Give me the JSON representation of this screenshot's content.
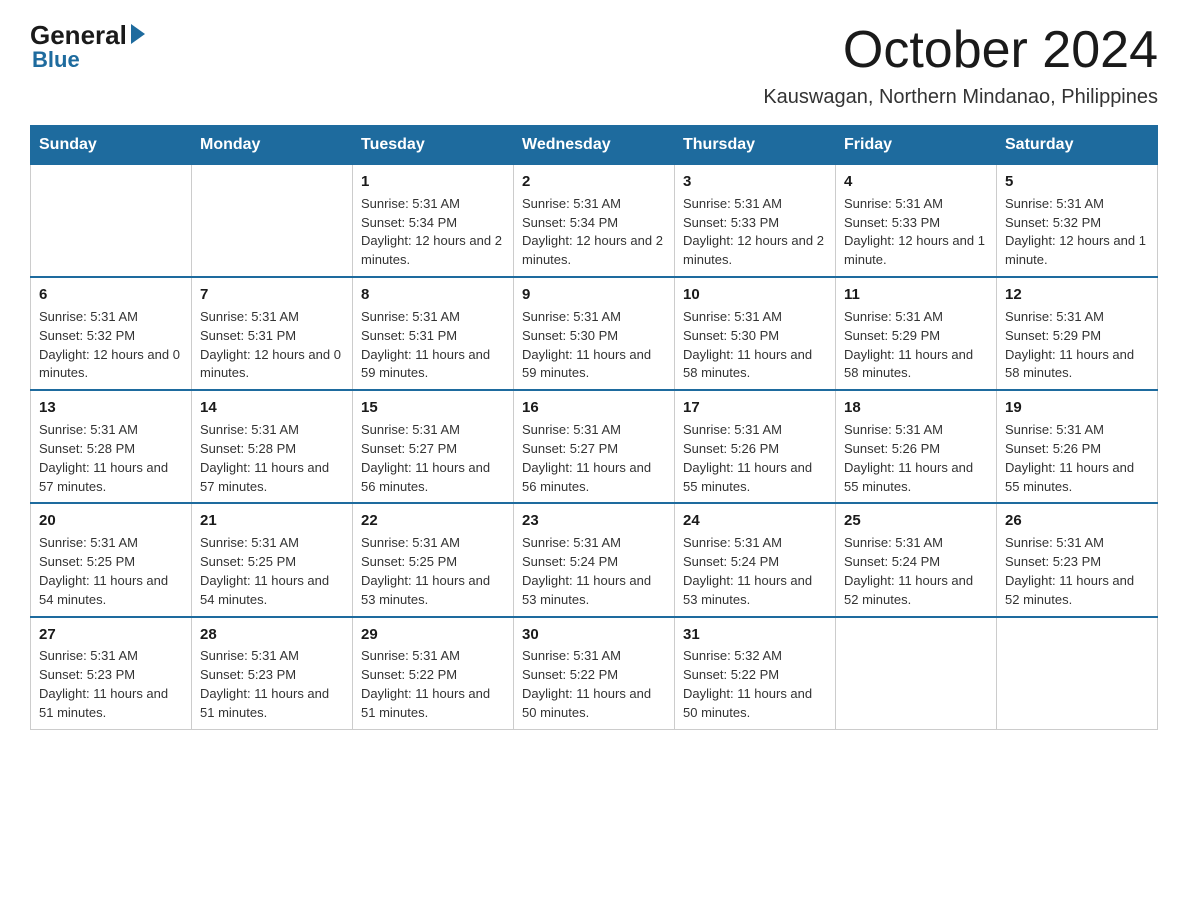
{
  "logo": {
    "general": "General",
    "blue": "Blue"
  },
  "title": "October 2024",
  "subtitle": "Kauswagan, Northern Mindanao, Philippines",
  "days_header": [
    "Sunday",
    "Monday",
    "Tuesday",
    "Wednesday",
    "Thursday",
    "Friday",
    "Saturday"
  ],
  "weeks": [
    [
      {
        "day": "",
        "info": ""
      },
      {
        "day": "",
        "info": ""
      },
      {
        "day": "1",
        "info": "Sunrise: 5:31 AM\nSunset: 5:34 PM\nDaylight: 12 hours and 2 minutes."
      },
      {
        "day": "2",
        "info": "Sunrise: 5:31 AM\nSunset: 5:34 PM\nDaylight: 12 hours and 2 minutes."
      },
      {
        "day": "3",
        "info": "Sunrise: 5:31 AM\nSunset: 5:33 PM\nDaylight: 12 hours and 2 minutes."
      },
      {
        "day": "4",
        "info": "Sunrise: 5:31 AM\nSunset: 5:33 PM\nDaylight: 12 hours and 1 minute."
      },
      {
        "day": "5",
        "info": "Sunrise: 5:31 AM\nSunset: 5:32 PM\nDaylight: 12 hours and 1 minute."
      }
    ],
    [
      {
        "day": "6",
        "info": "Sunrise: 5:31 AM\nSunset: 5:32 PM\nDaylight: 12 hours and 0 minutes."
      },
      {
        "day": "7",
        "info": "Sunrise: 5:31 AM\nSunset: 5:31 PM\nDaylight: 12 hours and 0 minutes."
      },
      {
        "day": "8",
        "info": "Sunrise: 5:31 AM\nSunset: 5:31 PM\nDaylight: 11 hours and 59 minutes."
      },
      {
        "day": "9",
        "info": "Sunrise: 5:31 AM\nSunset: 5:30 PM\nDaylight: 11 hours and 59 minutes."
      },
      {
        "day": "10",
        "info": "Sunrise: 5:31 AM\nSunset: 5:30 PM\nDaylight: 11 hours and 58 minutes."
      },
      {
        "day": "11",
        "info": "Sunrise: 5:31 AM\nSunset: 5:29 PM\nDaylight: 11 hours and 58 minutes."
      },
      {
        "day": "12",
        "info": "Sunrise: 5:31 AM\nSunset: 5:29 PM\nDaylight: 11 hours and 58 minutes."
      }
    ],
    [
      {
        "day": "13",
        "info": "Sunrise: 5:31 AM\nSunset: 5:28 PM\nDaylight: 11 hours and 57 minutes."
      },
      {
        "day": "14",
        "info": "Sunrise: 5:31 AM\nSunset: 5:28 PM\nDaylight: 11 hours and 57 minutes."
      },
      {
        "day": "15",
        "info": "Sunrise: 5:31 AM\nSunset: 5:27 PM\nDaylight: 11 hours and 56 minutes."
      },
      {
        "day": "16",
        "info": "Sunrise: 5:31 AM\nSunset: 5:27 PM\nDaylight: 11 hours and 56 minutes."
      },
      {
        "day": "17",
        "info": "Sunrise: 5:31 AM\nSunset: 5:26 PM\nDaylight: 11 hours and 55 minutes."
      },
      {
        "day": "18",
        "info": "Sunrise: 5:31 AM\nSunset: 5:26 PM\nDaylight: 11 hours and 55 minutes."
      },
      {
        "day": "19",
        "info": "Sunrise: 5:31 AM\nSunset: 5:26 PM\nDaylight: 11 hours and 55 minutes."
      }
    ],
    [
      {
        "day": "20",
        "info": "Sunrise: 5:31 AM\nSunset: 5:25 PM\nDaylight: 11 hours and 54 minutes."
      },
      {
        "day": "21",
        "info": "Sunrise: 5:31 AM\nSunset: 5:25 PM\nDaylight: 11 hours and 54 minutes."
      },
      {
        "day": "22",
        "info": "Sunrise: 5:31 AM\nSunset: 5:25 PM\nDaylight: 11 hours and 53 minutes."
      },
      {
        "day": "23",
        "info": "Sunrise: 5:31 AM\nSunset: 5:24 PM\nDaylight: 11 hours and 53 minutes."
      },
      {
        "day": "24",
        "info": "Sunrise: 5:31 AM\nSunset: 5:24 PM\nDaylight: 11 hours and 53 minutes."
      },
      {
        "day": "25",
        "info": "Sunrise: 5:31 AM\nSunset: 5:24 PM\nDaylight: 11 hours and 52 minutes."
      },
      {
        "day": "26",
        "info": "Sunrise: 5:31 AM\nSunset: 5:23 PM\nDaylight: 11 hours and 52 minutes."
      }
    ],
    [
      {
        "day": "27",
        "info": "Sunrise: 5:31 AM\nSunset: 5:23 PM\nDaylight: 11 hours and 51 minutes."
      },
      {
        "day": "28",
        "info": "Sunrise: 5:31 AM\nSunset: 5:23 PM\nDaylight: 11 hours and 51 minutes."
      },
      {
        "day": "29",
        "info": "Sunrise: 5:31 AM\nSunset: 5:22 PM\nDaylight: 11 hours and 51 minutes."
      },
      {
        "day": "30",
        "info": "Sunrise: 5:31 AM\nSunset: 5:22 PM\nDaylight: 11 hours and 50 minutes."
      },
      {
        "day": "31",
        "info": "Sunrise: 5:32 AM\nSunset: 5:22 PM\nDaylight: 11 hours and 50 minutes."
      },
      {
        "day": "",
        "info": ""
      },
      {
        "day": "",
        "info": ""
      }
    ]
  ]
}
